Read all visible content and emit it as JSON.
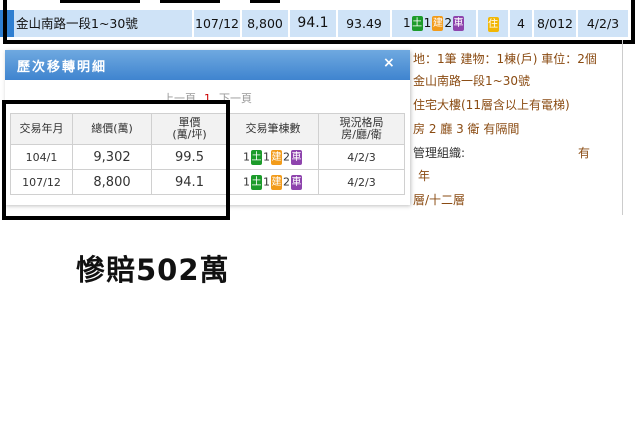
{
  "top_row": {
    "address": "金山南路一段1~30號",
    "date": "107/12",
    "total": "8,800",
    "unit_price": "94.1",
    "area": "93.49",
    "land_count": "1",
    "land_icon": "土",
    "build_count": "1",
    "build_icon": "建",
    "car_count": "2",
    "car_icon": "車",
    "use_icon": "住",
    "floor_count": "4",
    "floor_info": "8/012",
    "layout": "4/2/3"
  },
  "right_panel": {
    "line1": "地：1筆 建物：1棟(戶) 車位：2個",
    "line2": "金山南路一段1~30號",
    "line3": "住宅大樓(11層含以上有電梯)",
    "line4": "房 2 廳 3 衛 有隔間",
    "line5_label": "管理組織:",
    "line5_value": "有",
    "line6": "年",
    "line7": "層/十二層"
  },
  "popup": {
    "title": "歷次移轉明細",
    "close_icon": "×",
    "pager": {
      "prev": "上一頁",
      "current": "1",
      "next": "下一頁"
    },
    "headers": [
      "交易年月",
      "總價(萬)",
      "單價\n(萬/坪)",
      "交易筆棟數",
      "現況格局\n房/廳/衛"
    ],
    "rows": [
      {
        "date": "104/1",
        "total": "9,302",
        "unit": "99.5",
        "land": "1",
        "land_icon": "土",
        "build": "1",
        "build_icon": "建",
        "car": "2",
        "car_icon": "車",
        "layout": "4/2/3"
      },
      {
        "date": "107/12",
        "total": "8,800",
        "unit": "94.1",
        "land": "1",
        "land_icon": "土",
        "build": "1",
        "build_icon": "建",
        "car": "2",
        "car_icon": "車",
        "layout": "4/2/3"
      }
    ]
  },
  "caption": "慘賠502萬",
  "colors": {
    "header_blue": "#3f84cf",
    "row_blue": "#2f7fd1",
    "land_green": "#1c9b2a",
    "build_orange": "#f29b1a",
    "car_purple": "#8e44ad",
    "right_text": "#8a4b12"
  }
}
